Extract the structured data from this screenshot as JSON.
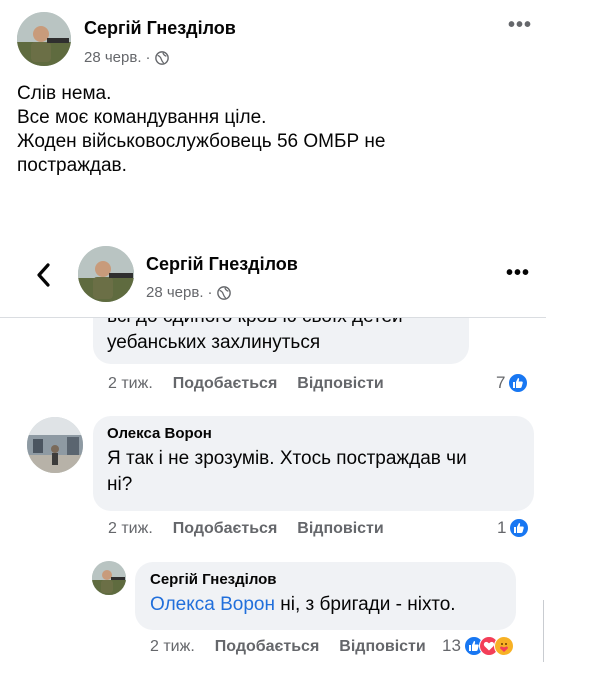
{
  "post": {
    "author": "Сергій Гнезділов",
    "date": "28 черв.",
    "separator": "·",
    "lines": [
      "Слів нема.",
      "Все моє командування ціле.",
      "Жоден військовослужбовець 56 ОМБР не",
      "постраждав."
    ]
  },
  "header2": {
    "author": "Сергій Гнезділов",
    "date": "28 черв.",
    "separator": "·"
  },
  "comments": [
    {
      "text_lines": [
        "всі до єдиного  кров ю своїх детей",
        "уебанських захлинуться"
      ],
      "time": "2 тиж.",
      "like_label": "Подобається",
      "reply_label": "Відповісти",
      "count": "7"
    },
    {
      "author": "Олекса Ворон",
      "text_lines": [
        "Я так і не зрозумів. Хтось постраждав чи",
        "ні?"
      ],
      "time": "2 тиж.",
      "like_label": "Подобається",
      "reply_label": "Відповісти",
      "count": "1"
    },
    {
      "author": "Сергій Гнезділов",
      "mention": "Олекса Ворон",
      "text": " ні, з бригади - ніхто.",
      "time": "2 тиж.",
      "like_label": "Подобається",
      "reply_label": "Відповісти",
      "count": "13"
    }
  ],
  "colors": {
    "like": "#1877f2",
    "heart": "#f33e58",
    "care": "#f7b125",
    "bubble": "#f0f2f5",
    "secondary_text": "#65676b",
    "mention": "#216fdb"
  }
}
